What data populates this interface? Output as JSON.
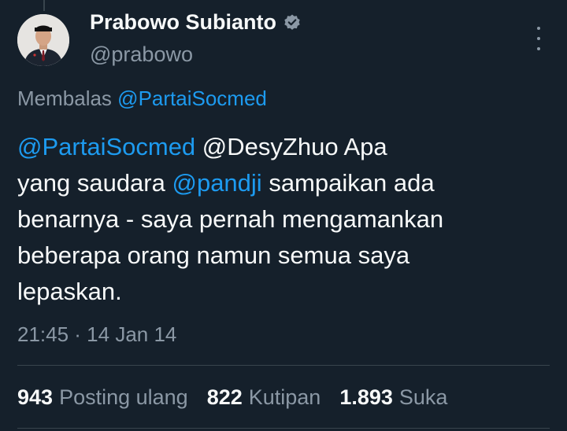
{
  "author": {
    "name": "Prabowo Subianto",
    "handle": "@prabowo"
  },
  "reply": {
    "prefix": "Membalas",
    "to": "@PartaiSocmed"
  },
  "tweet": {
    "line1_mention": "@PartaiSocmed",
    "line1_rest": " @DesyZhuo Apa",
    "line2_start": "yang saudara ",
    "line2_mention": "@pandji",
    "line2_rest": " sampaikan ada",
    "line3": "benarnya - saya pernah mengamankan",
    "line4": "beberapa orang namun semua saya",
    "line5": "lepaskan."
  },
  "timestamp": "21:45 · 14 Jan 14",
  "stats": {
    "reposts_count": "943",
    "reposts_label": "Posting ulang",
    "quotes_count": "822",
    "quotes_label": "Kutipan",
    "likes_count": "1.893",
    "likes_label": "Suka"
  },
  "colors": {
    "background": "#15202b",
    "link": "#1d9bf0",
    "secondary_text": "#8b98a5"
  },
  "icons": {
    "verified": "verified-badge-icon",
    "more": "more-options-icon"
  }
}
